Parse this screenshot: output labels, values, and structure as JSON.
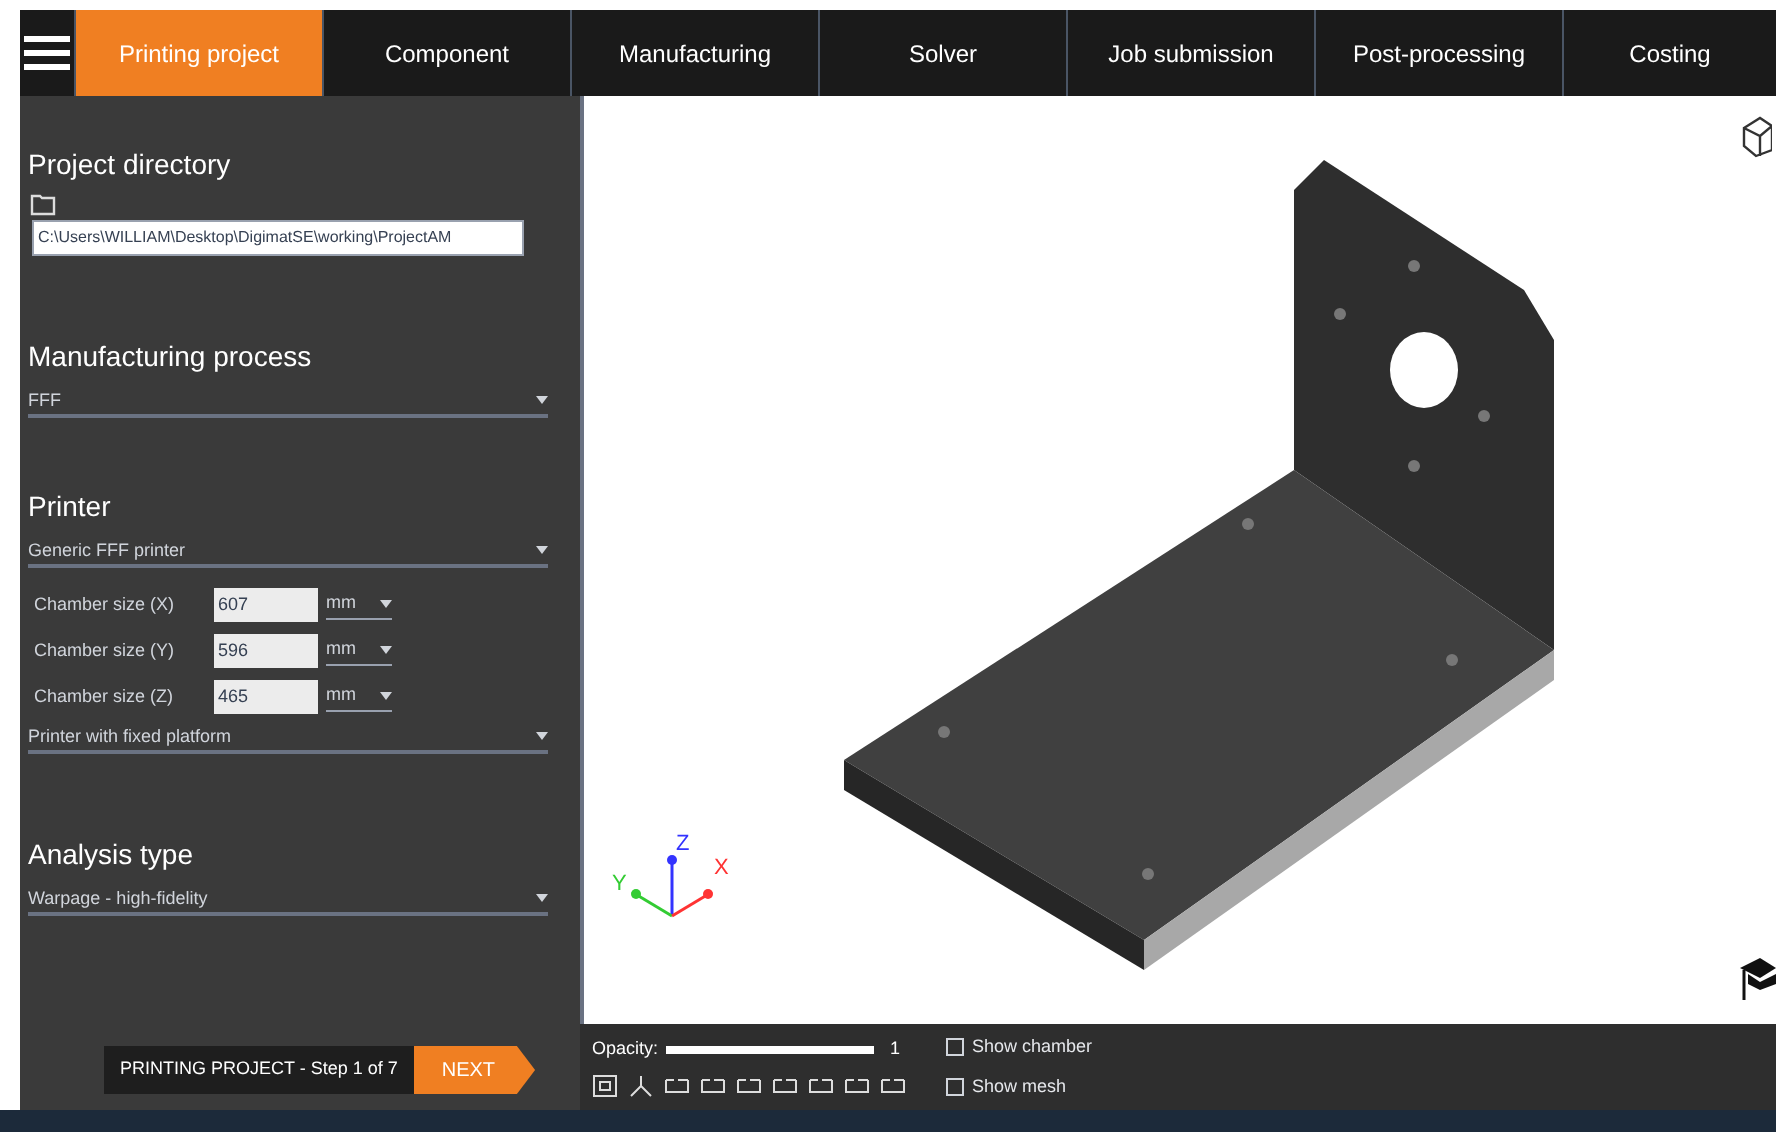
{
  "tabs": [
    {
      "label": "Printing project",
      "selected": true
    },
    {
      "label": "Component",
      "selected": false
    },
    {
      "label": "Manufacturing",
      "selected": false
    },
    {
      "label": "Solver",
      "selected": false
    },
    {
      "label": "Job submission",
      "selected": false
    },
    {
      "label": "Post-processing",
      "selected": false
    },
    {
      "label": "Costing",
      "selected": false
    }
  ],
  "project_directory": {
    "heading": "Project directory",
    "path": "C:\\Users\\WILLIAM\\Desktop\\DigimatSE\\working\\ProjectAM"
  },
  "manufacturing_process": {
    "heading": "Manufacturing process",
    "value": "FFF"
  },
  "printer": {
    "heading": "Printer",
    "value": "Generic FFF printer",
    "chamber": [
      {
        "label": "Chamber size (X)",
        "value": "607",
        "unit": "mm"
      },
      {
        "label": "Chamber size (Y)",
        "value": "596",
        "unit": "mm"
      },
      {
        "label": "Chamber size (Z)",
        "value": "465",
        "unit": "mm"
      }
    ],
    "platform": "Printer with fixed platform"
  },
  "analysis_type": {
    "heading": "Analysis type",
    "value": "Warpage - high-fidelity"
  },
  "step": {
    "label": "PRINTING PROJECT - Step 1 of 7",
    "next": "NEXT"
  },
  "viewport": {
    "axes": [
      "X",
      "Y",
      "Z"
    ]
  },
  "bottom_bar": {
    "opacity": {
      "label": "Opacity:",
      "level": 1,
      "reading": "1"
    },
    "checkboxes": [
      {
        "label": "Show chamber",
        "checked": false
      },
      {
        "label": "Show mesh",
        "checked": false
      }
    ]
  }
}
